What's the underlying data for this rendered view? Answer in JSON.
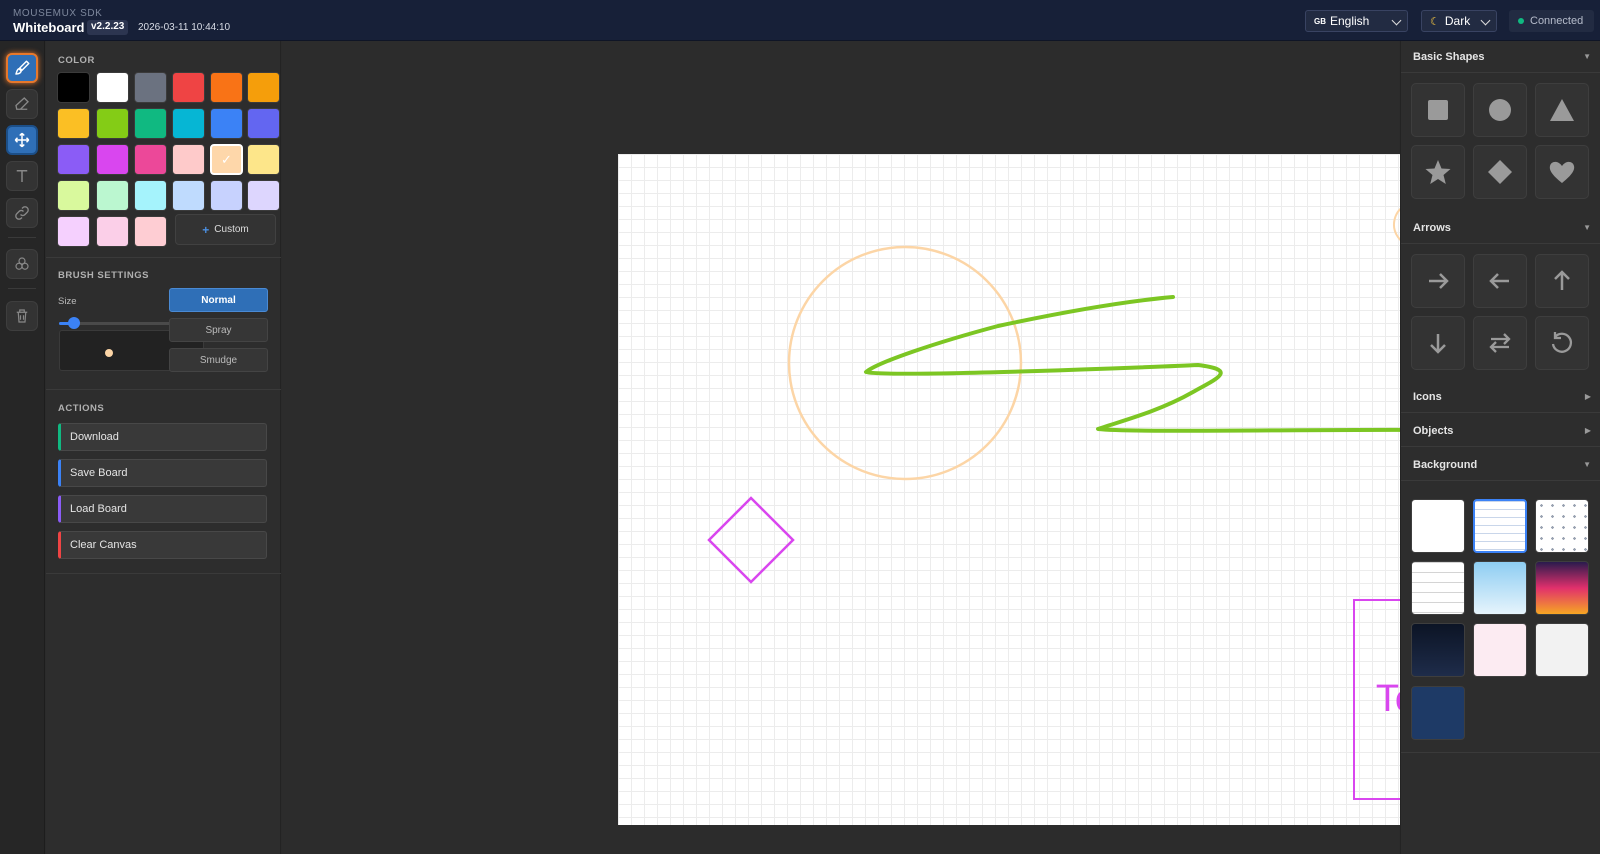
{
  "header": {
    "sdk_label": "MOUSEMUX SDK",
    "app_title": "Whiteboard",
    "version": "v2.2.23",
    "datetime": "2026-03-11 10:44:10",
    "language": "English",
    "language_flag": "GB",
    "theme": "Dark",
    "connection_status": "Connected"
  },
  "toolbar": {
    "tools": [
      {
        "name": "brush",
        "icon": "paintbrush-icon",
        "active": true
      },
      {
        "name": "eraser",
        "icon": "eraser-icon"
      },
      {
        "name": "move",
        "icon": "move-arrows-icon",
        "active": true
      },
      {
        "name": "text",
        "icon": "text-icon"
      },
      {
        "name": "link",
        "icon": "link-icon"
      },
      {
        "name": "layers",
        "icon": "circles-icon"
      },
      {
        "name": "delete",
        "icon": "trash-icon"
      }
    ]
  },
  "color_panel": {
    "section_label": "COLOR",
    "swatches": [
      "#000000",
      "#ffffff",
      "#6b7280",
      "#ef4444",
      "#f97316",
      "#f59e0b",
      "#fbbf24",
      "#84cc16",
      "#10b981",
      "#06b6d4",
      "#3b82f6",
      "#6366f1",
      "#8b5cf6",
      "#d946ef",
      "#ec4899",
      "#fecaca",
      "#fed7aa",
      "#fde68a",
      "#d9f99d",
      "#bbf7d0",
      "#a5f3fc",
      "#bfdbfe",
      "#c7d2fe",
      "#ddd6fe",
      "#f5d0fe",
      "#fbcfe8",
      "#fecdd3"
    ],
    "selected_index": 16,
    "custom_label": "Custom"
  },
  "brush_settings": {
    "section_label": "BRUSH SETTINGS",
    "size_label": "Size",
    "size_value": "5",
    "size_fraction": 0.1,
    "modes": [
      "Normal",
      "Spray",
      "Smudge"
    ],
    "active_mode": "Normal",
    "preview_color": "#fcd5a6"
  },
  "actions": {
    "section_label": "ACTIONS",
    "buttons": [
      {
        "label": "Download",
        "accent": "#10b981"
      },
      {
        "label": "Save Board",
        "accent": "#3b82f6"
      },
      {
        "label": "Load Board",
        "accent": "#8b5cf6"
      },
      {
        "label": "Clear Canvas",
        "accent": "#ef4444"
      }
    ]
  },
  "canvas": {
    "text_box_content": "Text here",
    "stroke_colors": {
      "green": "#7cc623",
      "peach": "#fcd5a6",
      "magenta": "#d946ef"
    }
  },
  "right_panel": {
    "basic_shapes": {
      "label": "Basic Shapes",
      "expanded": true,
      "items": [
        "square-icon",
        "circle-icon",
        "triangle-icon",
        "star-icon",
        "diamond-icon",
        "heart-icon"
      ]
    },
    "arrows": {
      "label": "Arrows",
      "expanded": true,
      "items": [
        "arrow-right-icon",
        "arrow-left-icon",
        "arrow-up-icon",
        "arrow-down-icon",
        "arrow-swap-icon",
        "rotate-icon"
      ]
    },
    "icons": {
      "label": "Icons",
      "expanded": false
    },
    "objects": {
      "label": "Objects",
      "expanded": false
    },
    "background": {
      "label": "Background",
      "expanded": true,
      "items": [
        "plain-white",
        "lined",
        "dotted",
        "ruled",
        "sky-gradient",
        "sunset-gradient",
        "night-gradient",
        "soft-pink",
        "light-gray",
        "navy"
      ],
      "selected_index": 1
    }
  }
}
